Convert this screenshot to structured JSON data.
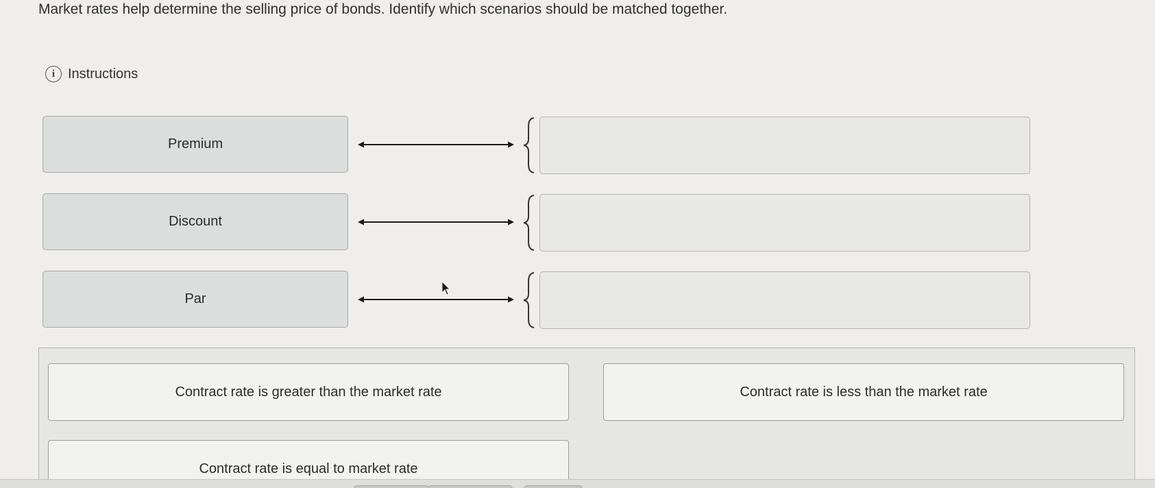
{
  "question": {
    "text": "Market rates help determine the selling price of bonds. Identify which scenarios should be matched together."
  },
  "instructions": {
    "icon": "info-icon",
    "label": "Instructions"
  },
  "terms": [
    {
      "label": "Premium"
    },
    {
      "label": "Discount"
    },
    {
      "label": "Par"
    }
  ],
  "drop_zones": [
    {
      "value": ""
    },
    {
      "value": ""
    },
    {
      "value": ""
    }
  ],
  "answer_choices": [
    {
      "label": "Contract rate is greater than the market rate"
    },
    {
      "label": "Contract rate is less than the market rate"
    },
    {
      "label": "Contract rate is equal to market rate"
    }
  ],
  "colors": {
    "page_bg": "#efeeec",
    "term_bg": "#dcdedd",
    "dropzone_bg": "#e8e8e6",
    "choice_bg": "#f2f2f0",
    "arrow": "#1a1a1a"
  }
}
